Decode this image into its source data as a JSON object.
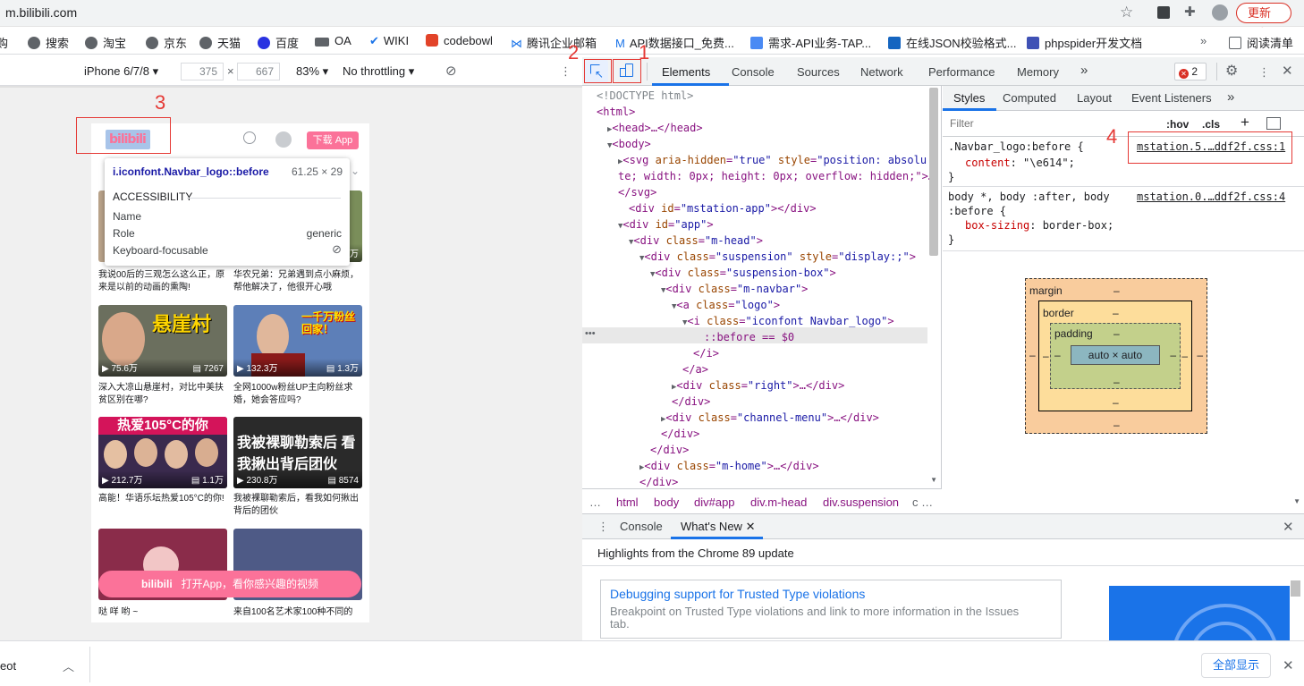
{
  "browser": {
    "url": "m.bilibili.com",
    "reload_label": "更新"
  },
  "bookmarks": [
    "购",
    "搜索",
    "淘宝",
    "京东",
    "天猫",
    "百度",
    "OA",
    "WIKI",
    "codebowl",
    "腾讯企业邮箱",
    "API数据接口_免费...",
    "需求-API业务-TAP...",
    "在线JSON校验格式...",
    "phpspider开发文档",
    "阅读清单"
  ],
  "device_toolbar": {
    "device": "iPhone 6/7/8",
    "width": "375",
    "height": "667",
    "zoom": "83%",
    "throttling": "No throttling"
  },
  "devtools": {
    "tabs": [
      "Elements",
      "Console",
      "Sources",
      "Network",
      "Performance",
      "Memory"
    ],
    "active_tab": "Elements",
    "error_count": "2"
  },
  "phone": {
    "download_button": "下载 App",
    "tooltip": {
      "selector": "i.iconfont.Navbar_logo::before",
      "size": "61.25 × 29",
      "section": "ACCESSIBILITY",
      "rows": [
        [
          "Name",
          ""
        ],
        [
          "Role",
          "generic"
        ],
        [
          "Keyboard-focusable",
          ""
        ]
      ]
    },
    "videos": [
      {
        "title": "我说00后的三观怎么这么正，原来是以前的动画的熏陶!",
        "plays": "",
        "danmaku": ""
      },
      {
        "title": "华农兄弟：兄弟遇到点小麻烦，帮他解决了，他很开心哦",
        "plays": "",
        "danmaku": "万"
      },
      {
        "title": "深入大凉山悬崖村，对比中美扶贫区别在哪?",
        "plays": "75.6万",
        "danmaku": "7267",
        "thumb_text": "悬崖村"
      },
      {
        "title": "全网1000w粉丝UP主向粉丝求婚，她会答应吗?",
        "plays": "132.3万",
        "danmaku": "1.3万",
        "thumb_text": "一千万粉丝回家！"
      },
      {
        "title": "高能！华语乐坛热爱105°C的你!",
        "plays": "212.7万",
        "danmaku": "1.1万",
        "thumb_text": "热爱105°C的你"
      },
      {
        "title": "我被裸聊勒索后，看我如何揪出背后的团伙",
        "plays": "230.8万",
        "danmaku": "8574",
        "thumb_text": "我被裸聊勒索后 看我揪出背后团伙"
      },
      {
        "title": "哒 咩 哟 ~",
        "plays": "",
        "danmaku": ""
      },
      {
        "title": "来自100名艺术家100种不同的",
        "plays": "",
        "danmaku": ""
      }
    ],
    "open_app_banner": "打开App，看你感兴趣的视频"
  },
  "dom_lines": [
    {
      "indent": 0,
      "text": "<!DOCTYPE html>",
      "cls": "cm"
    },
    {
      "indent": 0,
      "text": "<html>",
      "cls": "tg"
    },
    {
      "indent": 1,
      "text": "▶<head>…</head>",
      "cls": "tg"
    },
    {
      "indent": 1,
      "text": "▼<body>",
      "cls": "tg"
    },
    {
      "indent": 2,
      "text": "▶<svg aria-hidden=\"true\" style=\"position: absolu",
      "cls": "tg"
    },
    {
      "indent": 2,
      "text": "te; width: 0px; height: 0px; overflow: hidden;\">…",
      "cls": "tg"
    },
    {
      "indent": 2,
      "text": "</svg>",
      "cls": "tg"
    },
    {
      "indent": 3,
      "text": "<div id=\"mstation-app\"></div>",
      "cls": "tg"
    },
    {
      "indent": 2,
      "text": "▼<div id=\"app\">",
      "cls": "tg"
    },
    {
      "indent": 3,
      "text": "▼<div class=\"m-head\">",
      "cls": "tg"
    },
    {
      "indent": 4,
      "text": "▼<div class=\"suspension\" style=\"display:;\">",
      "cls": "tg"
    },
    {
      "indent": 5,
      "text": "▼<div class=\"suspension-box\">",
      "cls": "tg"
    },
    {
      "indent": 6,
      "text": "▼<div class=\"m-navbar\">",
      "cls": "tg"
    },
    {
      "indent": 7,
      "text": "▼<a class=\"logo\">",
      "cls": "tg"
    },
    {
      "indent": 8,
      "text": "▼<i class=\"iconfont Navbar_logo\">",
      "cls": "tg"
    },
    {
      "indent": 10,
      "text": "::before == $0",
      "cls": "sel"
    },
    {
      "indent": 9,
      "text": "</i>",
      "cls": "tg"
    },
    {
      "indent": 8,
      "text": "</a>",
      "cls": "tg"
    },
    {
      "indent": 7,
      "text": "▶<div class=\"right\">…</div>",
      "cls": "tg"
    },
    {
      "indent": 7,
      "text": "</div>",
      "cls": "tg"
    },
    {
      "indent": 6,
      "text": "▶<div class=\"channel-menu\">…</div>",
      "cls": "tg"
    },
    {
      "indent": 6,
      "text": "</div>",
      "cls": "tg"
    },
    {
      "indent": 5,
      "text": "</div>",
      "cls": "tg"
    },
    {
      "indent": 4,
      "text": "▶<div class=\"m-home\">…</div>",
      "cls": "tg"
    },
    {
      "indent": 4,
      "text": "</div>",
      "cls": "tg"
    }
  ],
  "breadcrumbs": [
    "html",
    "body",
    "div#app",
    "div.m-head",
    "div.suspension"
  ],
  "styles": {
    "tabs": [
      "Styles",
      "Computed",
      "Layout",
      "Event Listeners"
    ],
    "filter_placeholder": "Filter",
    "hov": ":hov",
    "cls": ".cls",
    "rule1": {
      "selector": ".Navbar_logo:before {",
      "prop": "content",
      "value": "\"\\e614\";",
      "source": "mstation.5.…ddf2f.css:1"
    },
    "rule2": {
      "selector": "body *, body :after, body",
      "selector2": ":before {",
      "prop": "box-sizing",
      "value": "border-box;",
      "source": "mstation.0.…ddf2f.css:4"
    },
    "box": {
      "margin": "margin",
      "border": "border",
      "padding": "padding",
      "content": "auto × auto",
      "dash": "–"
    }
  },
  "drawer": {
    "tabs": [
      "Console",
      "What's New"
    ],
    "highlight": "Highlights from the Chrome 89 update",
    "card_title": "Debugging support for Trusted Type violations",
    "card_desc": "Breakpoint on Trusted Type violations and link to more information in the Issues tab."
  },
  "download_bar": {
    "item": "eot",
    "show_all": "全部显示"
  },
  "annotations": [
    "1",
    "2",
    "3",
    "4"
  ]
}
